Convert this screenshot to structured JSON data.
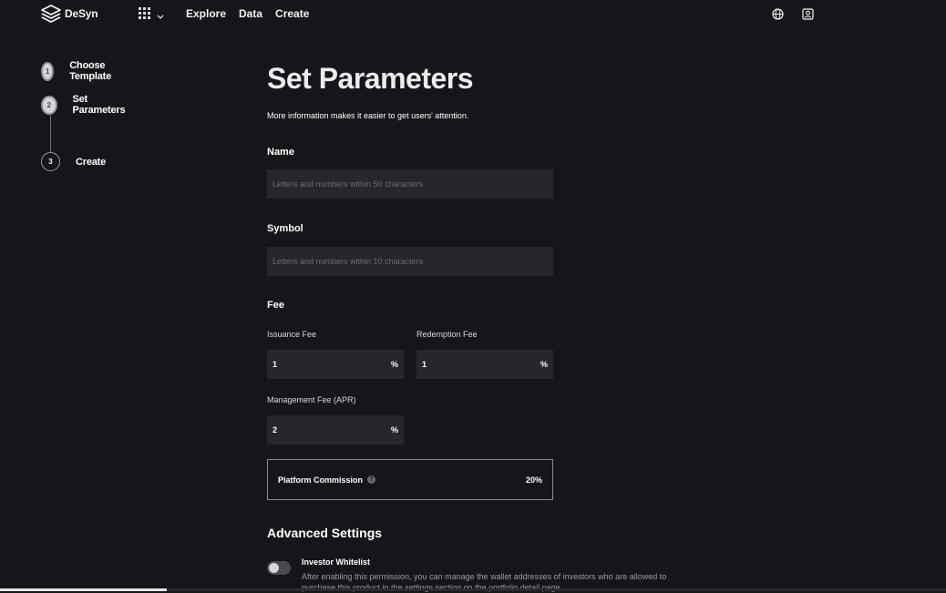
{
  "header": {
    "logo_text": "DeSyn",
    "nav": [
      "Explore",
      "Data",
      "Create"
    ],
    "icons": [
      "apps-grid-icon",
      "chevron-down-icon",
      "globe-icon",
      "account-icon"
    ]
  },
  "stepper": {
    "steps": [
      {
        "number": "1",
        "label": "Choose Template",
        "state": "done"
      },
      {
        "number": "2",
        "label": "Set Parameters",
        "state": "current"
      },
      {
        "number": "3",
        "label": "Create",
        "state": "pending"
      }
    ]
  },
  "form": {
    "title": "Set Parameters",
    "subtitle": "More information makes it easier to get users' attention.",
    "name": {
      "label": "Name",
      "placeholder": "Letters and numbers within 50 characters",
      "value": ""
    },
    "symbol": {
      "label": "Symbol",
      "placeholder": "Letters and numbers within 10 characters",
      "value": ""
    },
    "fee": {
      "label": "Fee",
      "issuance": {
        "label": "Issuance Fee",
        "value": "1",
        "unit": "%"
      },
      "redemption": {
        "label": "Redemption Fee",
        "value": "1",
        "unit": "%"
      },
      "management": {
        "label": "Management Fee (APR)",
        "value": "2",
        "unit": "%"
      }
    },
    "commission": {
      "label": "Platform Commission",
      "help": "?",
      "value": "20%"
    },
    "advanced": {
      "title": "Advanced Settings",
      "whitelist_title": "Investor Whitelist",
      "whitelist_desc": "After enabling this permission, you can manage the wallet addresses of investors who are allowed to purchase this product in the settings section on the portfolio detail page.",
      "whitelist_enabled": false
    }
  },
  "colors": {
    "background": "#16151a",
    "input": "#27262c",
    "text": "#ffffff",
    "muted": "#9a9aa0"
  }
}
